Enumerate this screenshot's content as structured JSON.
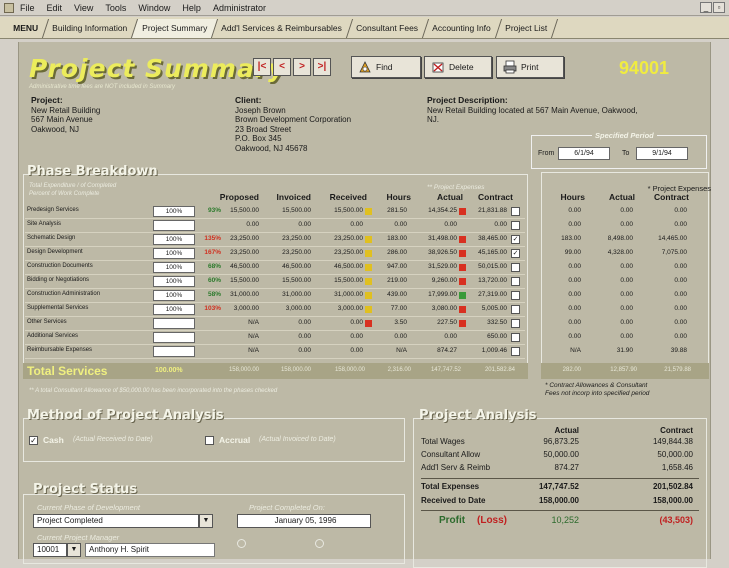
{
  "menubar": {
    "items": [
      "File",
      "Edit",
      "View",
      "Tools",
      "Window",
      "Help",
      "Administrator"
    ],
    "controls": [
      "_",
      "▫",
      "×"
    ]
  },
  "tabs": [
    {
      "label": "MENU",
      "active": false
    },
    {
      "label": "Building Information",
      "active": false
    },
    {
      "label": "Project Summary",
      "active": true
    },
    {
      "label": "Add'l Services & Reimbursables",
      "active": false
    },
    {
      "label": "Consultant Fees",
      "active": false
    },
    {
      "label": "Accounting Info",
      "active": false
    },
    {
      "label": "Project List",
      "active": false
    }
  ],
  "header": {
    "title": "Project Summary",
    "subnote": "Administrative time fees are NOT included in Summary",
    "nav": [
      "|<",
      "<",
      ">",
      ">|"
    ],
    "find_label": "Find",
    "delete_label": "Delete",
    "print_label": "Print",
    "project_number": "94001"
  },
  "project": {
    "label": "Project:",
    "line1": "New Retail Building",
    "line2": "567 Main Avenue",
    "line3": "Oakwood, NJ"
  },
  "client": {
    "label": "Client:",
    "line1": "Joseph Brown",
    "line2": "Brown Development Corporation",
    "line3": "23 Broad Street",
    "line4": "P.O. Box 345",
    "line5": "Oakwood, NJ 45678"
  },
  "description": {
    "label": "Project Description:",
    "line1": "New Retail Building located at 567 Main Avenue, Oakwood,",
    "line2": "NJ."
  },
  "period": {
    "title": "Specified Period",
    "from_label": "From",
    "from_value": "6/1/94",
    "to_label": "To",
    "to_value": "9/1/94"
  },
  "phase": {
    "title": "Phase Breakdown",
    "legend1": "Total Expenditure / of Completed",
    "legend2": "Percent of Work Complete",
    "headers": {
      "proposed": "Proposed",
      "invoiced": "Invoiced",
      "received": "Received",
      "hours": "Hours",
      "actual": "Actual",
      "contract": "Contract",
      "proj_exp": "** Project Expenses"
    },
    "rows": [
      {
        "name": "Predesign Services",
        "pct": "100%",
        "comp": "93%",
        "comp_color": "#2c7a2c",
        "proposed": "15,500.00",
        "invoiced": "15,500.00",
        "received": "15,500.00",
        "flag": "#e0c020",
        "hours": "281.50",
        "actual": "14,354.25",
        "flag2": "#d83020",
        "contract": "21,831.88",
        "cb": "",
        "phours": "0.00",
        "pactual": "0.00",
        "pcontract": "0.00"
      },
      {
        "name": "Site Analysis",
        "pct": "",
        "comp": "",
        "comp_color": "#2c7a2c",
        "proposed": "0.00",
        "invoiced": "0.00",
        "received": "0.00",
        "flag": "",
        "hours": "0.00",
        "actual": "0.00",
        "flag2": "",
        "contract": "0.00",
        "cb": "",
        "phours": "0.00",
        "pactual": "0.00",
        "pcontract": "0.00"
      },
      {
        "name": "Schematic Design",
        "pct": "100%",
        "comp": "135%",
        "comp_color": "#d03020",
        "proposed": "23,250.00",
        "invoiced": "23,250.00",
        "received": "23,250.00",
        "flag": "#e0c020",
        "hours": "183.00",
        "actual": "31,498.00",
        "flag2": "#d83020",
        "contract": "38,465.00",
        "cb": "✓",
        "phours": "183.00",
        "pactual": "8,498.00",
        "pcontract": "14,465.00"
      },
      {
        "name": "Design Development",
        "pct": "100%",
        "comp": "167%",
        "comp_color": "#d03020",
        "proposed": "23,250.00",
        "invoiced": "23,250.00",
        "received": "23,250.00",
        "flag": "#e0c020",
        "hours": "286.00",
        "actual": "38,926.50",
        "flag2": "#d83020",
        "contract": "45,165.00",
        "cb": "✓",
        "phours": "99.00",
        "pactual": "4,328.00",
        "pcontract": "7,075.00"
      },
      {
        "name": "Construction Documents",
        "pct": "100%",
        "comp": "68%",
        "comp_color": "#2c7a2c",
        "proposed": "46,500.00",
        "invoiced": "46,500.00",
        "received": "46,500.00",
        "flag": "#e0c020",
        "hours": "947.00",
        "actual": "31,529.00",
        "flag2": "#d83020",
        "contract": "50,015.00",
        "cb": "",
        "phours": "0.00",
        "pactual": "0.00",
        "pcontract": "0.00"
      },
      {
        "name": "Bidding or Negotiations",
        "pct": "100%",
        "comp": "60%",
        "comp_color": "#2c7a2c",
        "proposed": "15,500.00",
        "invoiced": "15,500.00",
        "received": "15,500.00",
        "flag": "#e0c020",
        "hours": "219.00",
        "actual": "9,260.00",
        "flag2": "#d83020",
        "contract": "13,720.00",
        "cb": "",
        "phours": "0.00",
        "pactual": "0.00",
        "pcontract": "0.00"
      },
      {
        "name": "Construction Administration",
        "pct": "100%",
        "comp": "58%",
        "comp_color": "#2c7a2c",
        "proposed": "31,000.00",
        "invoiced": "31,000.00",
        "received": "31,000.00",
        "flag": "#e0c020",
        "hours": "439.00",
        "actual": "17,999.00",
        "flag2": "#3a9a3a",
        "contract": "27,319.00",
        "cb": "",
        "phours": "0.00",
        "pactual": "0.00",
        "pcontract": "0.00"
      },
      {
        "name": "Supplemental Services",
        "pct": "100%",
        "comp": "103%",
        "comp_color": "#d03020",
        "proposed": "3,000.00",
        "invoiced": "3,000.00",
        "received": "3,000.00",
        "flag": "#e0c020",
        "hours": "77.00",
        "actual": "3,080.00",
        "flag2": "#d83020",
        "contract": "5,005.00",
        "cb": "",
        "phours": "0.00",
        "pactual": "0.00",
        "pcontract": "0.00"
      },
      {
        "name": "Other Services",
        "pct": "",
        "comp": "",
        "comp_color": "#2c7a2c",
        "proposed": "N/A",
        "invoiced": "0.00",
        "received": "0.00",
        "flag": "#d83020",
        "hours": "3.50",
        "actual": "227.50",
        "flag2": "#d83020",
        "contract": "332.50",
        "cb": "",
        "phours": "0.00",
        "pactual": "0.00",
        "pcontract": "0.00"
      },
      {
        "name": "Additional Services",
        "pct": "",
        "comp": "",
        "comp_color": "#2c7a2c",
        "proposed": "N/A",
        "invoiced": "0.00",
        "received": "0.00",
        "flag": "",
        "hours": "0.00",
        "actual": "0.00",
        "flag2": "",
        "contract": "650.00",
        "cb": "",
        "phours": "0.00",
        "pactual": "0.00",
        "pcontract": "0.00"
      },
      {
        "name": "Reimbursable Expenses",
        "pct": "",
        "comp": "",
        "comp_color": "#2c7a2c",
        "proposed": "N/A",
        "invoiced": "0.00",
        "received": "0.00",
        "flag": "",
        "hours": "N/A",
        "actual": "874.27",
        "flag2": "",
        "contract": "1,009.46",
        "cb": "",
        "phours": "N/A",
        "pactual": "31.90",
        "pcontract": "39.88"
      }
    ],
    "total": {
      "label": "Total Services",
      "pct": "100.00%",
      "proposed": "158,000.00",
      "invoiced": "158,000.00",
      "received": "158,000.00",
      "hours": "2,316.00",
      "actual": "147,747.52",
      "contract": "201,582.84",
      "phours": "282.00",
      "pactual": "12,857.90",
      "pcontract": "21,579.88"
    },
    "footnote": "** A total Consultant Allowance of $50,000.00 has been incorporated into the phases checked"
  },
  "proj_expenses": {
    "title": "* Project Expenses",
    "h_hours": "Hours",
    "h_actual": "Actual",
    "h_contract": "Contract",
    "note1": "* Contract Allowances & Consultant",
    "note2": "Fees not incorp into specified period"
  },
  "method": {
    "title": "Method of Project Analysis",
    "cash_label": "Cash",
    "cash_sub": "(Actual Received to Date)",
    "accrual_label": "Accrual",
    "accrual_sub": "(Actual Invoiced to Date)"
  },
  "status": {
    "title": "Project Status",
    "phase_label": "Current Phase of Development",
    "phase_value": "Project Completed",
    "completed_label": "Project Completed On:",
    "completed_value": "January 05, 1996",
    "manager_label": "Current Project Manager",
    "manager_id": "10001",
    "manager_name": "Anthony H. Spirit"
  },
  "analysis": {
    "title": "Project Analysis",
    "h_actual": "Actual",
    "h_contract": "Contract",
    "rows": [
      {
        "label": "Total Wages",
        "actual": "96,873.25",
        "contract": "149,844.38"
      },
      {
        "label": "Consultant Allow",
        "actual": "50,000.00",
        "contract": "50,000.00"
      },
      {
        "label": "Add'l Serv & Reimb",
        "actual": "874.27",
        "contract": "1,658.46"
      }
    ],
    "total_expenses_label": "Total Expenses",
    "total_expenses_actual": "147,747.52",
    "total_expenses_contract": "201,502.84",
    "received_label": "Received to Date",
    "received_actual": "158,000.00",
    "received_contract": "158,000.00",
    "profit_label": "Profit",
    "loss_label": "(Loss)",
    "profit_actual": "10,252",
    "profit_contract": "(43,503)"
  }
}
